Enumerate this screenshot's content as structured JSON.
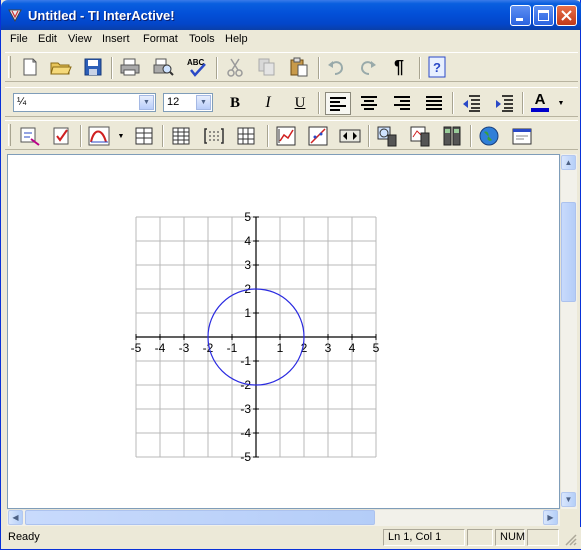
{
  "window": {
    "title": "Untitled - TI InterActive!"
  },
  "menubar": {
    "items": [
      "File",
      "Edit",
      "View",
      "Insert",
      "Format",
      "Tools",
      "Help"
    ]
  },
  "format_toolbar": {
    "font_value": "¼",
    "size_value": "12",
    "bold_label": "B",
    "italic_label": "I",
    "underline_label": "U",
    "font_color_label": "A",
    "font_color": "#0000cc"
  },
  "standard_toolbar": {
    "spell_label": "ABC",
    "pilcrow_label": "¶",
    "help_label": "?"
  },
  "graph": {
    "x_ticks": [
      "-5",
      "-4",
      "-3",
      "-2",
      "-1",
      "1",
      "2",
      "3",
      "4",
      "5"
    ],
    "y_ticks": [
      "5",
      "4",
      "3",
      "2",
      "1",
      "-1",
      "-2",
      "-3",
      "-4",
      "-5"
    ],
    "xlim": [
      -5,
      5
    ],
    "ylim": [
      -5,
      5
    ],
    "grid": true,
    "curve_color": "#2a2ae0",
    "circle": {
      "center": [
        0,
        0
      ],
      "radius": 2
    }
  },
  "status": {
    "ready": "Ready",
    "position": "Ln 1, Col 1",
    "num": "NUM"
  }
}
